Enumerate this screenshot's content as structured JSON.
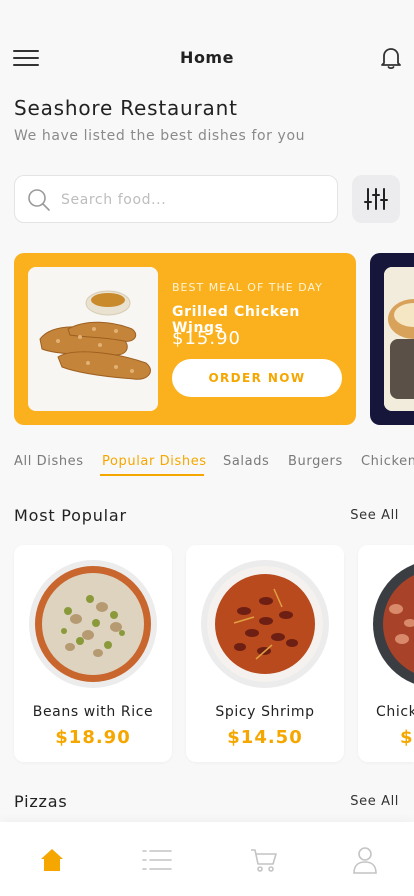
{
  "header": {
    "title": "Home",
    "menu_icon": "hamburger-menu-icon",
    "notification_icon": "bell-icon"
  },
  "restaurant": {
    "name": "Seashore Restaurant",
    "subtitle": "We have listed the best dishes for you"
  },
  "search": {
    "placeholder": "Search food...",
    "value": "",
    "icon": "search-icon",
    "filter_icon": "sliders-icon"
  },
  "promo": {
    "tag": "BEST MEAL OF THE DAY",
    "name": "Grilled Chicken Wings",
    "price": "$15.90",
    "button_label": "ORDER NOW",
    "color": "#fbb11d"
  },
  "categories": {
    "items": [
      "All Dishes",
      "Popular Dishes",
      "Salads",
      "Burgers",
      "Chicken"
    ],
    "active": "Popular Dishes"
  },
  "most_popular": {
    "title": "Most Popular",
    "see_all": "See All",
    "items": [
      {
        "name": "Beans with Rice",
        "price": "$18.90"
      },
      {
        "name": "Spicy Shrimp",
        "price": "$14.50"
      },
      {
        "name": "Chick",
        "price": "$"
      }
    ]
  },
  "pizzas": {
    "title": "Pizzas",
    "see_all": "See All"
  },
  "bottom_nav": {
    "items": [
      "home-icon",
      "list-icon",
      "cart-icon",
      "profile-icon"
    ],
    "active": "home-icon"
  },
  "colors": {
    "accent": "#f5a700",
    "promo_bg": "#fbb11d",
    "promo2_bg": "#16163a"
  }
}
